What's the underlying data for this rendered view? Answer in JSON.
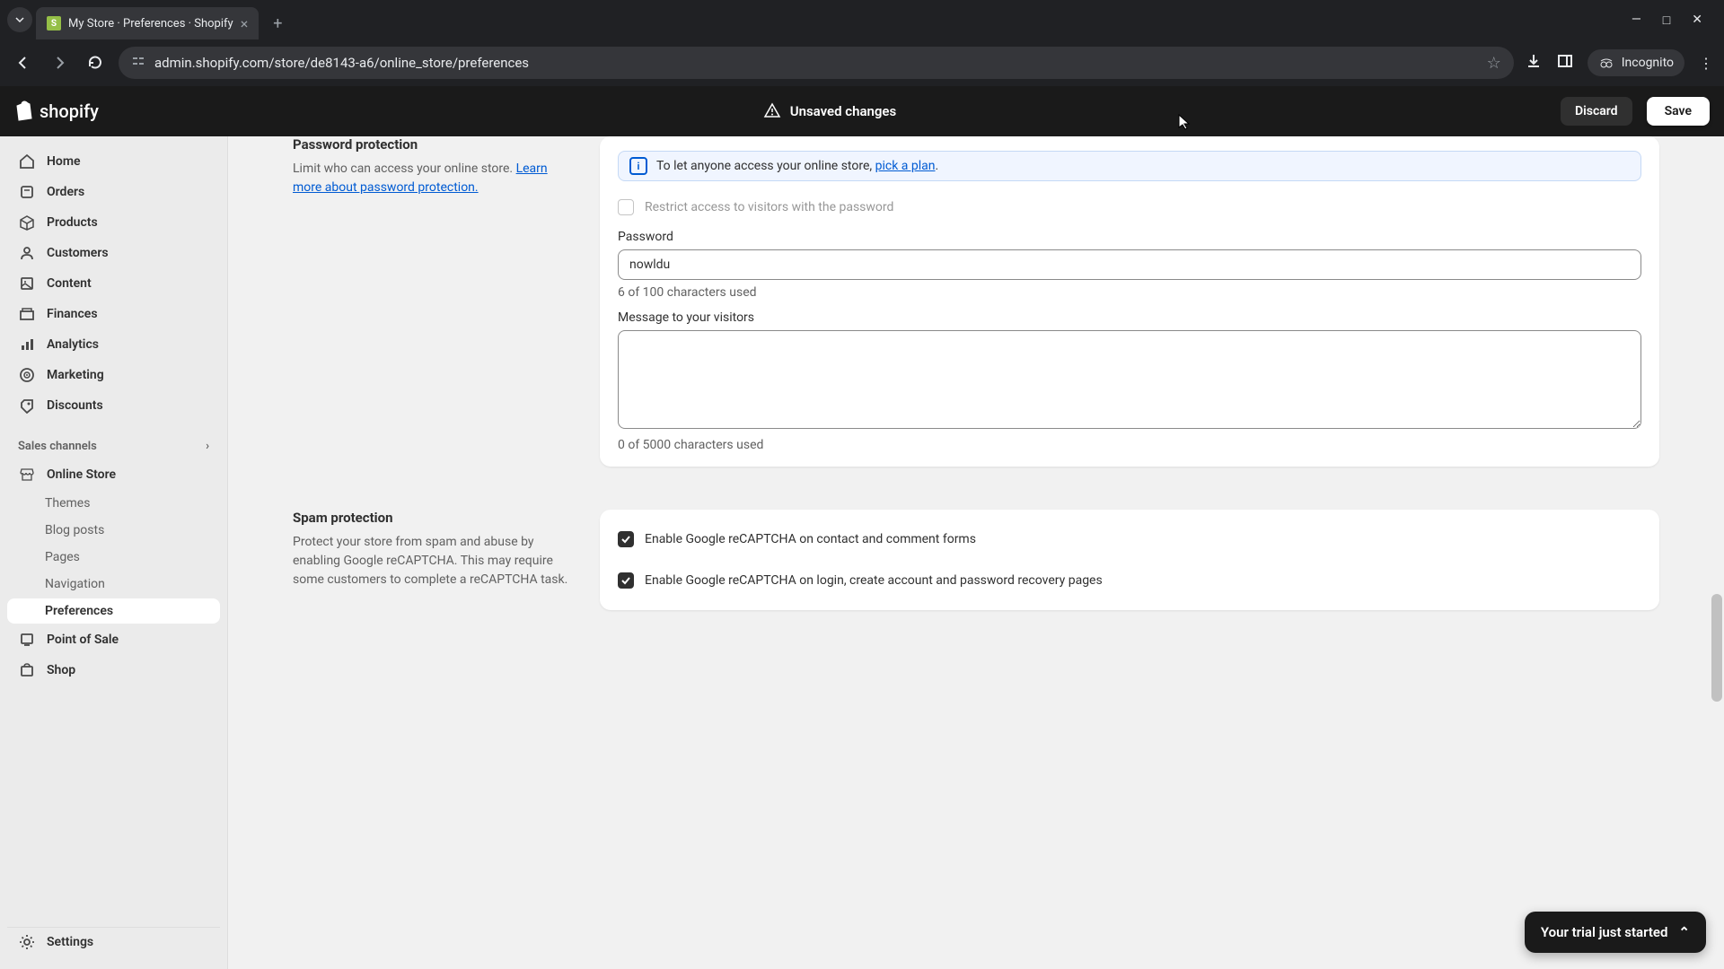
{
  "browser": {
    "tab_title": "My Store · Preferences · Shopify",
    "url": "admin.shopify.com/store/de8143-a6/online_store/preferences",
    "incognito_label": "Incognito"
  },
  "header": {
    "logo_text": "shopify",
    "unsaved_label": "Unsaved changes",
    "discard_label": "Discard",
    "save_label": "Save"
  },
  "sidebar": {
    "home": "Home",
    "orders": "Orders",
    "products": "Products",
    "customers": "Customers",
    "content": "Content",
    "finances": "Finances",
    "analytics": "Analytics",
    "marketing": "Marketing",
    "discounts": "Discounts",
    "sales_channels_header": "Sales channels",
    "online_store": "Online Store",
    "themes": "Themes",
    "blog_posts": "Blog posts",
    "pages": "Pages",
    "navigation": "Navigation",
    "preferences": "Preferences",
    "point_of_sale": "Point of Sale",
    "shop": "Shop",
    "settings": "Settings"
  },
  "password_section": {
    "title": "Password protection",
    "desc_prefix": "Limit who can access your online store. ",
    "desc_link": "Learn more about password protection.",
    "banner_prefix": "To let anyone access your online store, ",
    "banner_link": "pick a plan",
    "banner_suffix": ".",
    "restrict_label": "Restrict access to visitors with the password",
    "password_label": "Password",
    "password_value": "nowldu",
    "password_helper": "6 of 100 characters used",
    "message_label": "Message to your visitors",
    "message_value": "",
    "message_helper": "0 of 5000 characters used"
  },
  "spam_section": {
    "title": "Spam protection",
    "desc": "Protect your store from spam and abuse by enabling Google reCAPTCHA. This may require some customers to complete a reCAPTCHA task.",
    "option1": "Enable Google reCAPTCHA on contact and comment forms",
    "option2": "Enable Google reCAPTCHA on login, create account and password recovery pages"
  },
  "trial_badge": "Your trial just started"
}
